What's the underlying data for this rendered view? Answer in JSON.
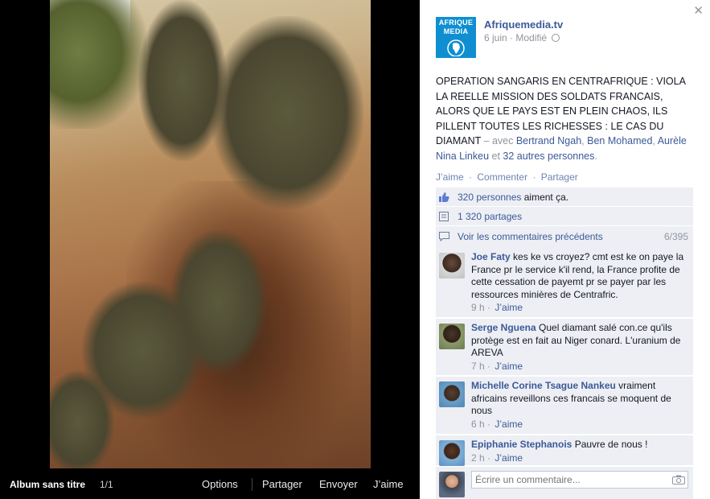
{
  "photo_viewer": {
    "album_title": "Album sans titre",
    "counter": "1/1",
    "actions": [
      "Options",
      "Partager",
      "Envoyer",
      "J’aime"
    ]
  },
  "post": {
    "logo_line1": "AFRIQUE",
    "logo_line2": "MEDIA",
    "page_name": "Afriquemedia.tv",
    "date": "6 juin",
    "edited": "Modifié",
    "text": "OPERATION SANGARIS EN CENTRAFRIQUE : VIOLA LA REELLE MISSION DES SOLDATS FRANCAIS, ALORS QUE LE PAYS EST EN PLEIN CHAOS, ILS PILLENT TOUTES LES RICHESSES : LE CAS DU DIAMANT",
    "with_label": "– avec",
    "tagged": [
      "Bertrand Ngah",
      "Ben Mohamed",
      "Aurèle Nina Linkeu"
    ],
    "and_label": "et",
    "others": "32 autres personnes",
    "comma": ",",
    "period": "."
  },
  "actions": {
    "like": "J’aime",
    "comment": "Commenter",
    "share": "Partager"
  },
  "stats": {
    "likes_link": "320 personnes",
    "likes_suffix": " aiment ça.",
    "shares": "1 320 partages",
    "prev_comments": "Voir les commentaires précédents",
    "comment_count": "6/395"
  },
  "comments": [
    {
      "name": "Joe Faty",
      "text": "kes ke vs croyez? cmt est ke on paye la France pr le service k'il rend, la France profite de cette cessation de payemt pr se payer par les ressources minières de Centrafric.",
      "time": "9 h",
      "like": "J’aime"
    },
    {
      "name": "Serge Nguena",
      "text": "Quel diamant salé con.ce qu'ils protège est en fait au Niger conard. L'uranium de AREVA",
      "time": "7 h",
      "like": "J’aime"
    },
    {
      "name": "Michelle Corine Tsague Nankeu",
      "text": "vraiment africains reveillons ces francais se moquent de nous",
      "time": "6 h",
      "like": "J’aime"
    },
    {
      "name": "Epiphanie Stephanois",
      "text": "Pauvre de nous !",
      "time": "2 h",
      "like": "J’aime"
    }
  ],
  "composer": {
    "placeholder": "Écrire un commentaire..."
  },
  "colors": {
    "link": "#3b5998",
    "panel_bg": "#edeff4",
    "logo_bg": "#0f8fd1"
  },
  "icons": [
    "close-icon",
    "globe-icon",
    "thumbs-up-icon",
    "share-icon",
    "comment-icon",
    "camera-icon"
  ]
}
